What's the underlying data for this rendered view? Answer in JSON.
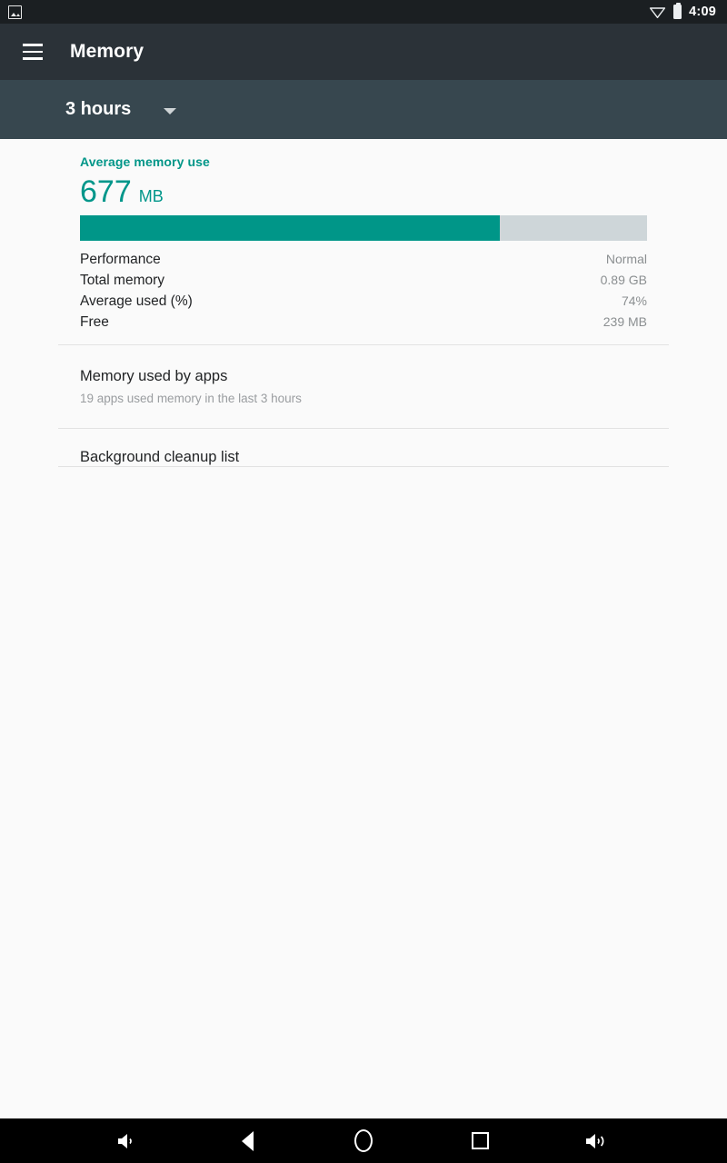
{
  "status_bar": {
    "notification_icon": "photo-icon",
    "wifi_icon": "wifi-no-signal-icon",
    "battery_icon": "battery-full-icon",
    "time": "4:09"
  },
  "toolbar": {
    "menu_icon": "hamburger-menu-icon",
    "title": "Memory"
  },
  "subheader": {
    "spinner_value": "3 hours",
    "spinner_arrow_icon": "chevron-down-icon"
  },
  "summary": {
    "label": "Average memory use",
    "value": "677",
    "unit": "MB",
    "progress_percent": 74,
    "accent_color": "#009688",
    "track_color": "#ced6d9"
  },
  "details": [
    {
      "key": "Performance",
      "value": "Normal"
    },
    {
      "key": "Total memory",
      "value": "0.89 GB"
    },
    {
      "key": "Average used (%)",
      "value": "74%"
    },
    {
      "key": "Free",
      "value": "239 MB"
    }
  ],
  "list_items": [
    {
      "title": "Memory used by apps",
      "subtitle": "19 apps used memory in the last 3 hours"
    },
    {
      "title": "Background cleanup list",
      "subtitle": ""
    }
  ],
  "nav_bar": {
    "volume_down": "volume-down-icon",
    "back": "back-icon",
    "home": "home-icon",
    "recents": "recents-icon",
    "volume_up": "volume-up-icon"
  }
}
